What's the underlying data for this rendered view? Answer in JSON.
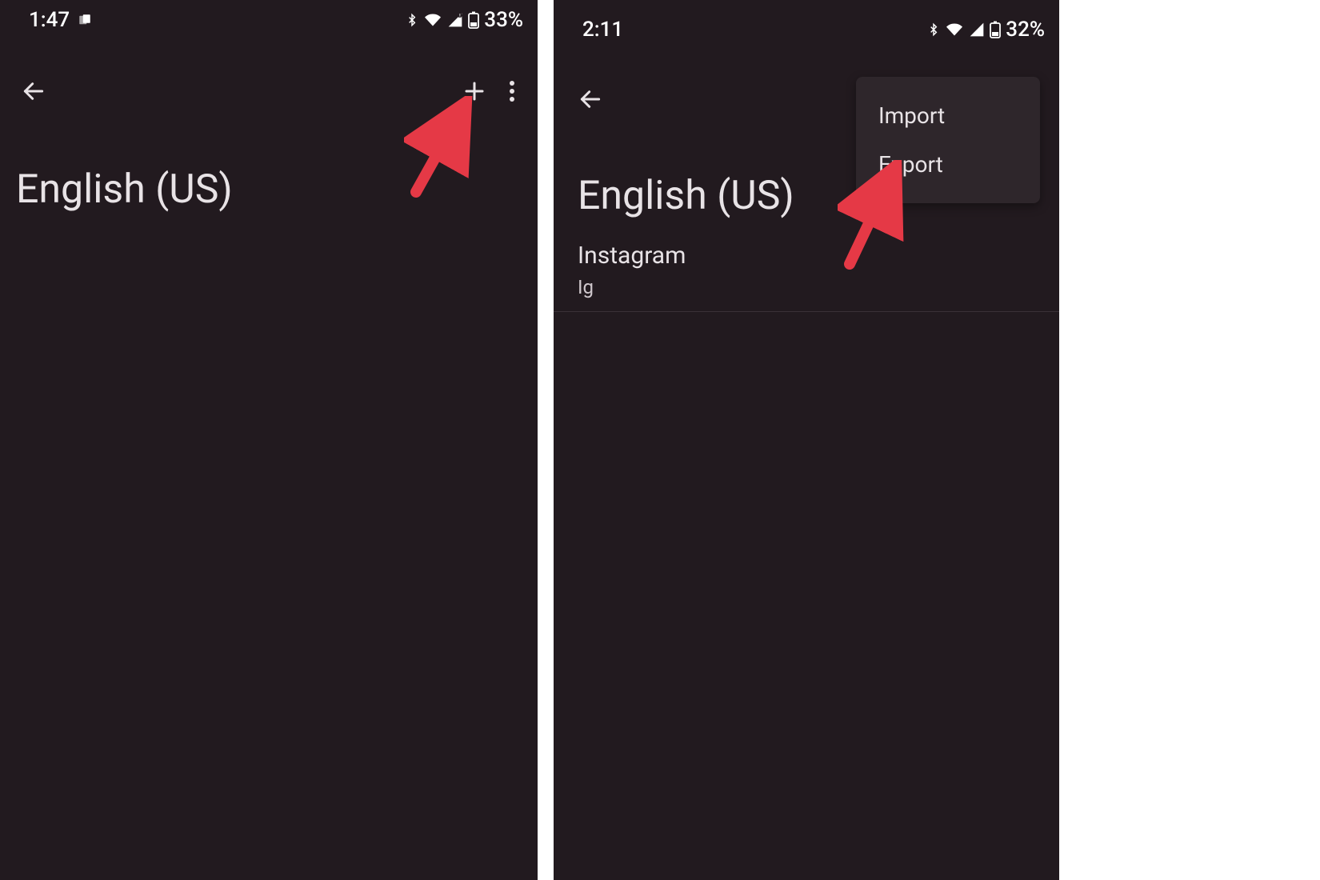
{
  "left": {
    "status": {
      "time": "1:47",
      "battery_pct": "33%"
    },
    "title": "English (US)"
  },
  "right": {
    "status": {
      "time": "2:11",
      "battery_pct": "32%"
    },
    "title": "English (US)",
    "entry": {
      "word": "Instagram",
      "shortcut": "Ig"
    },
    "menu": {
      "import": "Import",
      "export": "Export"
    }
  }
}
